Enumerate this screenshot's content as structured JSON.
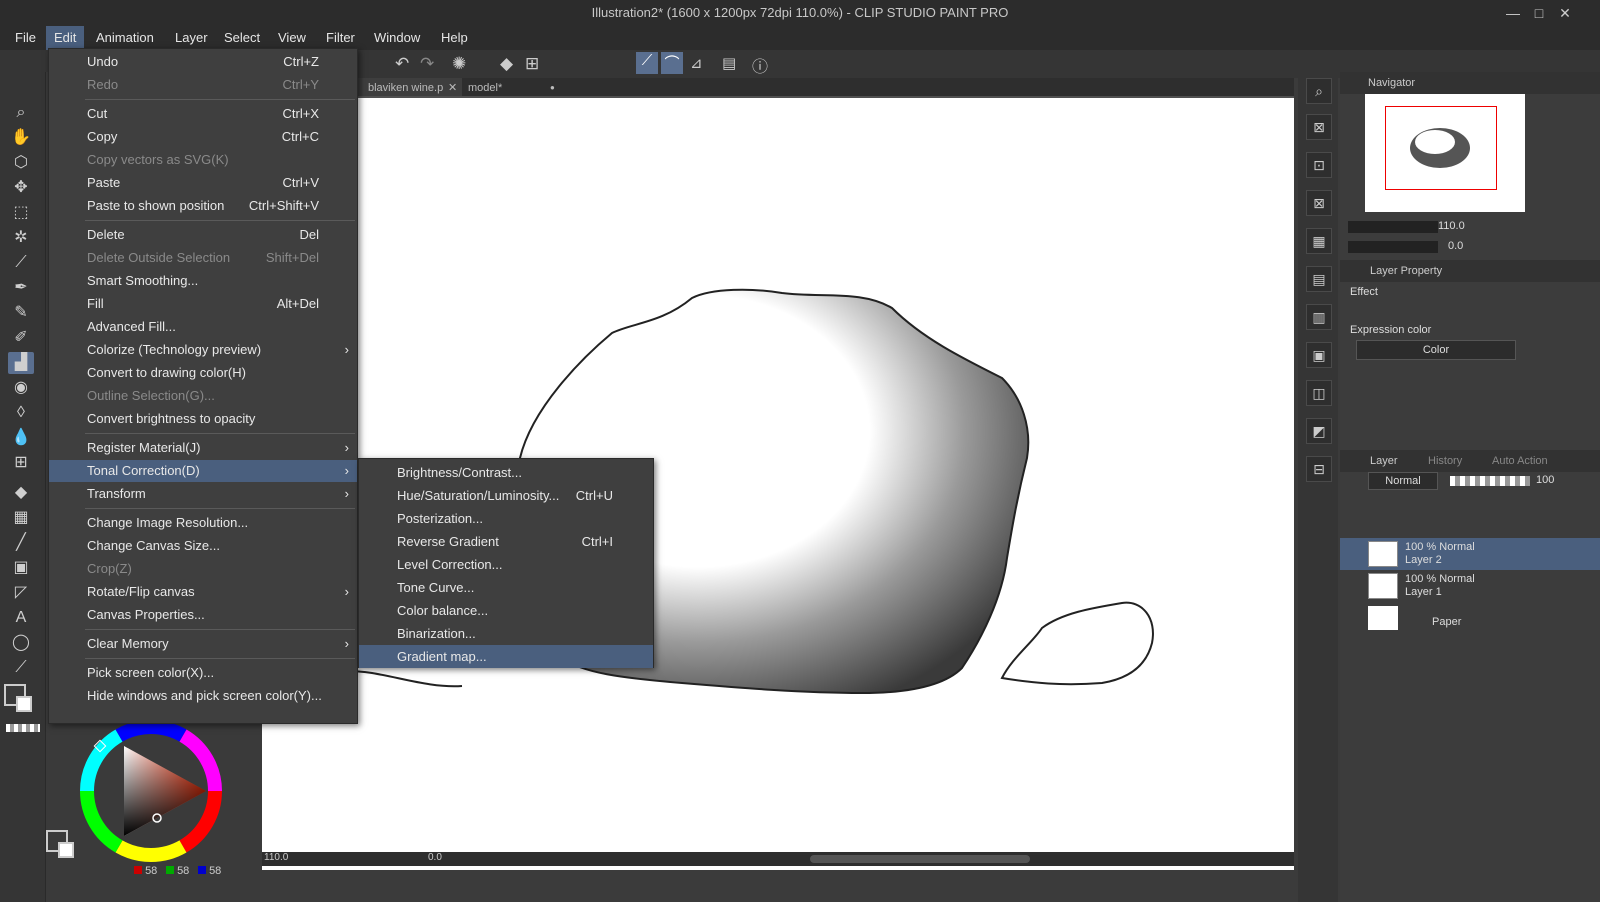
{
  "window": {
    "title": "Illustration2* (1600 x 1200px 72dpi 110.0%) - CLIP STUDIO PAINT PRO",
    "minimize": "—",
    "maximize": "□",
    "close": "✕"
  },
  "menubar": [
    "File",
    "Edit",
    "Animation",
    "Layer",
    "Select",
    "View",
    "Filter",
    "Window",
    "Help"
  ],
  "tabs": [
    {
      "label": "blaviken wine.p",
      "close": "✕"
    },
    {
      "label": "model*",
      "close": "●"
    }
  ],
  "edit_menu": [
    {
      "label": "Undo",
      "shortcut": "Ctrl+Z",
      "disabled": false
    },
    {
      "label": "Redo",
      "shortcut": "Ctrl+Y",
      "disabled": true
    },
    {
      "label": "Cut",
      "shortcut": "Ctrl+X",
      "disabled": false
    },
    {
      "label": "Copy",
      "shortcut": "Ctrl+C",
      "disabled": false
    },
    {
      "label": "Copy vectors as SVG(K)",
      "shortcut": "",
      "disabled": true
    },
    {
      "label": "Paste",
      "shortcut": "Ctrl+V",
      "disabled": false
    },
    {
      "label": "Paste to shown position",
      "shortcut": "Ctrl+Shift+V",
      "disabled": false
    },
    {
      "label": "Delete",
      "shortcut": "Del",
      "disabled": false
    },
    {
      "label": "Delete Outside Selection",
      "shortcut": "Shift+Del",
      "disabled": true
    },
    {
      "label": "Smart Smoothing...",
      "shortcut": "",
      "disabled": false
    },
    {
      "label": "Fill",
      "shortcut": "Alt+Del",
      "disabled": false
    },
    {
      "label": "Advanced Fill...",
      "shortcut": "",
      "disabled": false
    },
    {
      "label": "Colorize (Technology preview)",
      "shortcut": "",
      "disabled": false
    },
    {
      "label": "Convert to drawing color(H)",
      "shortcut": "",
      "disabled": false
    },
    {
      "label": "Outline Selection(G)...",
      "shortcut": "",
      "disabled": true
    },
    {
      "label": "Convert brightness to opacity",
      "shortcut": "",
      "disabled": false
    },
    {
      "label": "Register Material(J)",
      "shortcut": "",
      "disabled": false
    },
    {
      "label": "Tonal Correction(D)",
      "shortcut": "",
      "disabled": false
    },
    {
      "label": "Transform",
      "shortcut": "",
      "disabled": false
    },
    {
      "label": "Change Image Resolution...",
      "shortcut": "",
      "disabled": false
    },
    {
      "label": "Change Canvas Size...",
      "shortcut": "",
      "disabled": false
    },
    {
      "label": "Crop(Z)",
      "shortcut": "",
      "disabled": true
    },
    {
      "label": "Rotate/Flip canvas",
      "shortcut": "",
      "disabled": false
    },
    {
      "label": "Canvas Properties...",
      "shortcut": "",
      "disabled": false
    },
    {
      "label": "Clear Memory",
      "shortcut": "",
      "disabled": false
    },
    {
      "label": "Pick screen color(X)...",
      "shortcut": "",
      "disabled": false
    },
    {
      "label": "Hide windows and pick screen color(Y)...",
      "shortcut": "",
      "disabled": false
    }
  ],
  "submenu_arrow": "›",
  "tonal_submenu": [
    {
      "label": "Brightness/Contrast...",
      "shortcut": ""
    },
    {
      "label": "Hue/Saturation/Luminosity...",
      "shortcut": "Ctrl+U"
    },
    {
      "label": "Posterization...",
      "shortcut": ""
    },
    {
      "label": "Reverse Gradient",
      "shortcut": "Ctrl+I"
    },
    {
      "label": "Level Correction...",
      "shortcut": ""
    },
    {
      "label": "Tone Curve...",
      "shortcut": ""
    },
    {
      "label": "Color balance...",
      "shortcut": ""
    },
    {
      "label": "Binarization...",
      "shortcut": ""
    },
    {
      "label": "Gradient map...",
      "shortcut": ""
    }
  ],
  "navigator": {
    "title": "Navigator",
    "zoom": "110.0",
    "rotation": "0.0"
  },
  "layer_property": {
    "title": "Layer Property",
    "effect_label": "Effect",
    "expression_label": "Expression color",
    "expression_value": "Color"
  },
  "layer_panel": {
    "tabs": [
      "Layer",
      "History",
      "Auto Action"
    ],
    "blend_mode": "Normal",
    "opacity": "100",
    "layers": [
      {
        "mode": "100 % Normal",
        "name": "Layer 2",
        "selected": true
      },
      {
        "mode": "100 % Normal",
        "name": "Layer 1",
        "selected": false
      },
      {
        "mode": "",
        "name": "Paper",
        "selected": false
      }
    ]
  },
  "status": {
    "zoom": "110.0",
    "angle": "0.0"
  },
  "color": {
    "r": "58",
    "g": "58",
    "b": "58",
    "accent": "#4a5f7e"
  }
}
